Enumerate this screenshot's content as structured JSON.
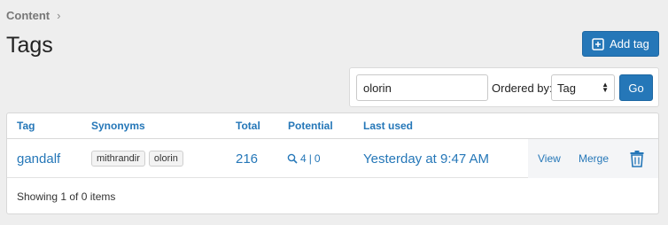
{
  "breadcrumb": {
    "label": "Content",
    "separator": "›"
  },
  "page": {
    "title": "Tags"
  },
  "toolbar": {
    "add_label": "Add tag"
  },
  "filter": {
    "query": "olorin",
    "order_label": "Ordered by:",
    "order_value": "Tag",
    "go_label": "Go"
  },
  "table": {
    "headers": {
      "tag": "Tag",
      "synonyms": "Synonyms",
      "total": "Total",
      "potential": "Potential",
      "last_used": "Last used"
    },
    "rows": [
      {
        "tag": "gandalf",
        "synonyms": [
          "mithrandir",
          "olorin"
        ],
        "total": "216",
        "potential_a": "4",
        "potential_sep": "|",
        "potential_b": "0",
        "last_used": "Yesterday at 9:47 AM",
        "view_label": "View",
        "merge_label": "Merge"
      }
    ],
    "footer": "Showing 1 of 0 items"
  },
  "colors": {
    "accent": "#2577b8",
    "background": "#eeeeee"
  },
  "icons": {
    "add": "plus-square-icon",
    "search": "search-icon",
    "delete": "trash-icon",
    "breadcrumb": "chevron-right-icon"
  }
}
